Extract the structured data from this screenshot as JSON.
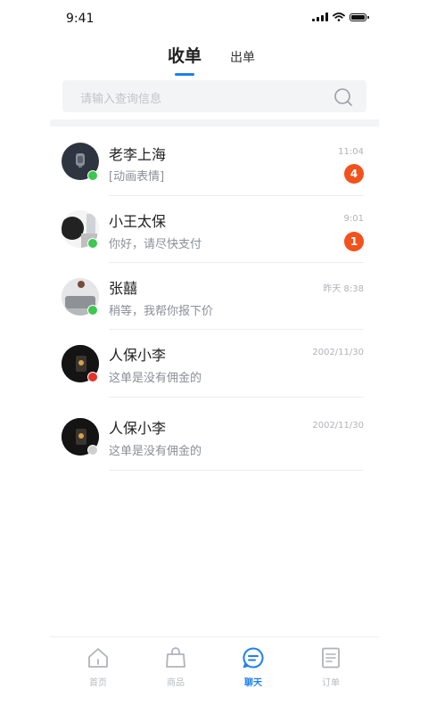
{
  "status_bar": {
    "time": "9:41"
  },
  "tabs": {
    "active": "收单",
    "inactive": "出单"
  },
  "search": {
    "placeholder": "请输入查询信息"
  },
  "chats": [
    {
      "name": "老李上海",
      "message": "[动画表情]",
      "time": "11:04",
      "unread": "4",
      "status": "online"
    },
    {
      "name": "小王太保",
      "message": "你好，请尽快支付",
      "time": "9:01",
      "unread": "1",
      "status": "online"
    },
    {
      "name": "张囍",
      "message": "稍等，我帮你报下价",
      "time": "昨天 8:38",
      "unread": "",
      "status": "online"
    },
    {
      "name": "人保小李",
      "message": "这单是没有佣金的",
      "time": "2002/11/30",
      "unread": "",
      "status": "busy"
    },
    {
      "name": "人保小李",
      "message": "这单是没有佣金的",
      "time": "2002/11/30",
      "unread": "",
      "status": "offline"
    }
  ],
  "nav": [
    {
      "label": "首页",
      "icon": "home-icon",
      "active": false
    },
    {
      "label": "商品",
      "icon": "shopping-bag-icon",
      "active": false
    },
    {
      "label": "聊天",
      "icon": "chat-icon",
      "active": true
    },
    {
      "label": "订单",
      "icon": "order-icon",
      "active": false
    }
  ],
  "colors": {
    "accent": "#1e7ef5",
    "badge": "#f2521b",
    "online": "#3cc74f",
    "busy": "#e8312a",
    "offline": "#cfcfcf"
  }
}
